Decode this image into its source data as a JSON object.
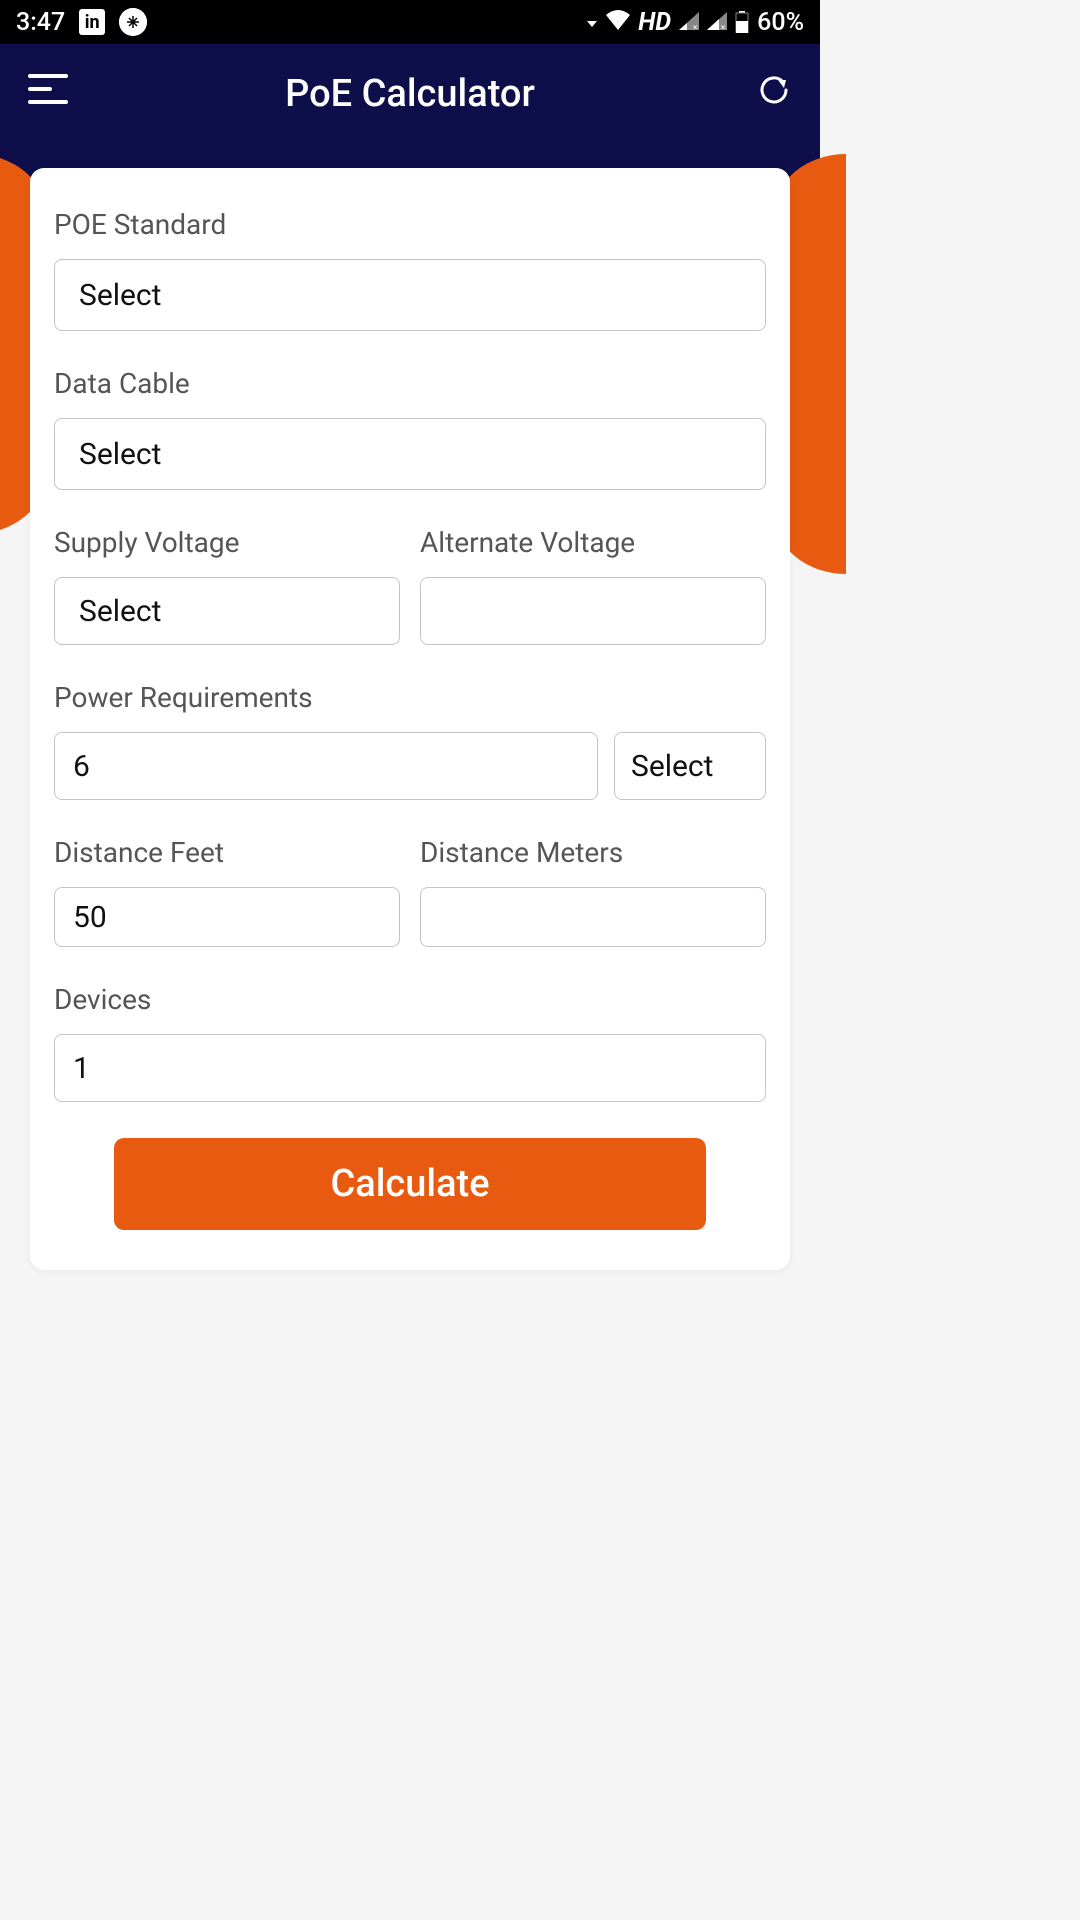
{
  "status_bar": {
    "time": "3:47",
    "hd_label": "HD",
    "battery_percent": "60%"
  },
  "header": {
    "title": "PoE Calculator"
  },
  "form": {
    "poe_standard": {
      "label": "POE Standard",
      "value": "Select"
    },
    "data_cable": {
      "label": "Data Cable",
      "value": "Select"
    },
    "supply_voltage": {
      "label": "Supply Voltage",
      "value": "Select"
    },
    "alternate_voltage": {
      "label": "Alternate Voltage",
      "value": ""
    },
    "power_requirements": {
      "label": "Power Requirements",
      "value": "6",
      "unit": "Select"
    },
    "distance_feet": {
      "label": "Distance Feet",
      "value": "50"
    },
    "distance_meters": {
      "label": "Distance Meters",
      "value": ""
    },
    "devices": {
      "label": "Devices",
      "value": "1"
    },
    "calculate_label": "Calculate"
  }
}
